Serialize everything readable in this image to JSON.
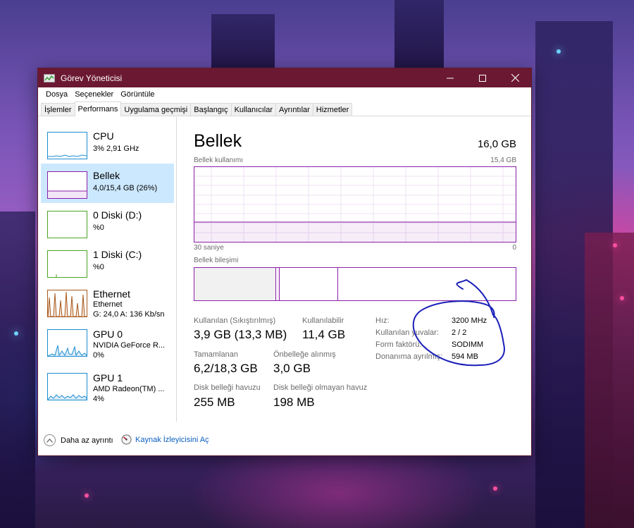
{
  "window": {
    "title": "Görev Yöneticisi",
    "controls": [
      "minimize",
      "maximize",
      "close"
    ]
  },
  "menubar": {
    "items": [
      "Dosya",
      "Seçenekler",
      "Görüntüle"
    ]
  },
  "tabs": [
    {
      "label": "İşlemler",
      "active": false
    },
    {
      "label": "Performans",
      "active": true
    },
    {
      "label": "Uygulama geçmişi",
      "active": false
    },
    {
      "label": "Başlangıç",
      "active": false
    },
    {
      "label": "Kullanıcılar",
      "active": false
    },
    {
      "label": "Ayrıntılar",
      "active": false
    },
    {
      "label": "Hizmetler",
      "active": false
    }
  ],
  "sidebar": {
    "items": [
      {
        "title": "CPU",
        "line1": "3% 2,91 GHz",
        "line2": "",
        "color": "#1b8dd0",
        "selected": false
      },
      {
        "title": "Bellek",
        "line1": "4,0/15,4 GB (26%)",
        "line2": "",
        "color": "#8b1fa8",
        "selected": true
      },
      {
        "title": "0 Diski (D:)",
        "line1": "%0",
        "line2": "",
        "color": "#4aa520",
        "selected": false
      },
      {
        "title": "1 Diski (C:)",
        "line1": "%0",
        "line2": "",
        "color": "#4aa520",
        "selected": false
      },
      {
        "title": "Ethernet",
        "line1": "Ethernet",
        "line2": "G: 24,0 A: 136 Kb/sn",
        "color": "#a7581c",
        "selected": false
      },
      {
        "title": "GPU 0",
        "line1": "NVIDIA GeForce R...",
        "line2": "0%",
        "color": "#1b8dd0",
        "selected": false
      },
      {
        "title": "GPU 1",
        "line1": "AMD Radeon(TM) ...",
        "line2": "4%",
        "color": "#1b8dd0",
        "selected": false
      }
    ]
  },
  "main": {
    "title": "Bellek",
    "total": "16,0 GB",
    "usage_label": "Bellek kullanımı",
    "usage_max": "15,4 GB",
    "time_left": "30 saniye",
    "time_right": "0",
    "composition_label": "Bellek bileşimi",
    "usage_fraction": 0.26,
    "stats": {
      "in_use_label": "Kullanılan (Sıkıştırılmış)",
      "in_use_value": "3,9 GB (13,3 MB)",
      "available_label": "Kullanılabilir",
      "available_value": "11,4 GB",
      "committed_label": "Tamamlanan",
      "committed_value": "6,2/18,3 GB",
      "cached_label": "Önbelleğe alınmış",
      "cached_value": "3,0 GB",
      "paged_label": "Disk belleği havuzu",
      "paged_value": "255 MB",
      "nonpaged_label": "Disk belleği olmayan havuz",
      "nonpaged_value": "198 MB"
    },
    "specs": [
      {
        "label": "Hız:",
        "value": "3200 MHz"
      },
      {
        "label": "Kullanılan yuvalar:",
        "value": "2 / 2"
      },
      {
        "label": "Form faktörü:",
        "value": "SODIMM"
      },
      {
        "label": "Donanıma ayrılmış:",
        "value": "594 MB"
      }
    ]
  },
  "footer": {
    "fewer_details": "Daha az ayrıntı",
    "resource_monitor": "Kaynak İzleyicisini Aç"
  },
  "colors": {
    "titlebar": "#6b1833",
    "memory_accent": "#8b1fa8",
    "annotation": "#1a1fb8",
    "selection": "#cce8ff",
    "link": "#0b5fbf"
  }
}
